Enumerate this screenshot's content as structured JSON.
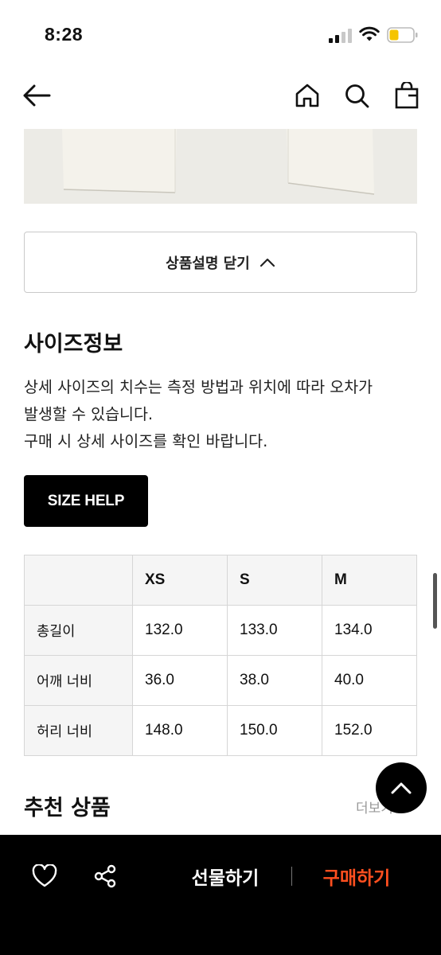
{
  "status_bar": {
    "time": "8:28"
  },
  "collapse_button": {
    "label": "상품설명 닫기"
  },
  "size_info": {
    "title": "사이즈정보",
    "description": [
      "상세 사이즈의 치수는 측정 방법과 위치에 따라 오차가",
      "발생할 수 있습니다.",
      "구매 시 상세 사이즈를 확인 바랍니다."
    ],
    "size_help_label": "SIZE HELP"
  },
  "size_table": {
    "headers": [
      "",
      "XS",
      "S",
      "M"
    ],
    "rows": [
      {
        "label": "총길이",
        "values": [
          "132.0",
          "133.0",
          "134.0"
        ]
      },
      {
        "label": "어깨 너비",
        "values": [
          "36.0",
          "38.0",
          "40.0"
        ]
      },
      {
        "label": "허리 너비",
        "values": [
          "148.0",
          "150.0",
          "152.0"
        ]
      }
    ]
  },
  "recommended": {
    "title": "추천 상품",
    "more_label": "더보기"
  },
  "bottom_bar": {
    "gift_label": "선물하기",
    "buy_label": "구매하기"
  },
  "colors": {
    "buy_accent": "#ff4f1f",
    "battery": "#f5c400",
    "product_bg": "#ecebe6"
  },
  "icons": [
    "back-arrow-icon",
    "home-icon",
    "search-icon",
    "bag-icon",
    "chevron-up-icon",
    "heart-icon",
    "share-icon",
    "scroll-top-icon"
  ]
}
